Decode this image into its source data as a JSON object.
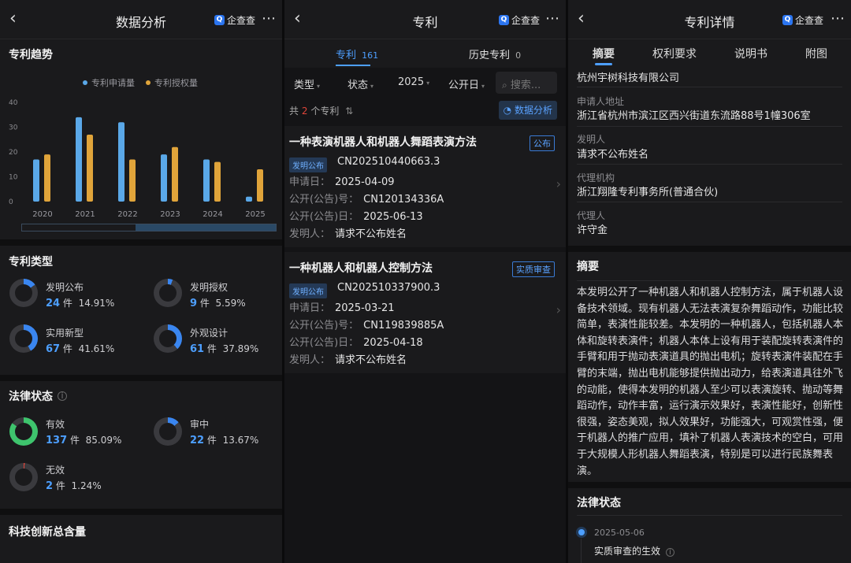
{
  "brand": {
    "name": "企查查",
    "logo_letter": "Q"
  },
  "panel1": {
    "title": "数据分析",
    "trend_title": "专利趋势",
    "type_title": "专利类型",
    "legal_title": "法律状态",
    "innovation_title": "科技创新总含量",
    "types": [
      {
        "label": "发明公布",
        "count": "24",
        "unit": "件",
        "pct": "14.91%",
        "ratio": 0.1491
      },
      {
        "label": "发明授权",
        "count": "9",
        "unit": "件",
        "pct": "5.59%",
        "ratio": 0.0559
      },
      {
        "label": "实用新型",
        "count": "67",
        "unit": "件",
        "pct": "41.61%",
        "ratio": 0.4161
      },
      {
        "label": "外观设计",
        "count": "61",
        "unit": "件",
        "pct": "37.89%",
        "ratio": 0.3789
      }
    ],
    "legal": [
      {
        "label": "有效",
        "count": "137",
        "unit": "件",
        "pct": "85.09%",
        "ratio": 0.8509,
        "color": "#3ec46d"
      },
      {
        "label": "审中",
        "count": "22",
        "unit": "件",
        "pct": "13.67%",
        "ratio": 0.1367,
        "color": "#3a86f0"
      },
      {
        "label": "无效",
        "count": "2",
        "unit": "件",
        "pct": "1.24%",
        "ratio": 0.0124,
        "color": "#e0453a"
      }
    ]
  },
  "chart_data": {
    "type": "bar",
    "categories": [
      "2020",
      "2021",
      "2022",
      "2023",
      "2024",
      "2025"
    ],
    "series": [
      {
        "name": "专利申请量",
        "values": [
          17,
          34,
          32,
          19,
          17,
          2
        ],
        "color": "#5aa8e8"
      },
      {
        "name": "专利授权量",
        "values": [
          19,
          27,
          17,
          22,
          16,
          13
        ],
        "color": "#e0a43a"
      }
    ],
    "yticks": [
      "0",
      "10",
      "20",
      "30",
      "40"
    ],
    "ylim": [
      0,
      40
    ],
    "legend": "top-center"
  },
  "panel2": {
    "title": "专利",
    "tabs": [
      {
        "label": "专利",
        "count": "161"
      },
      {
        "label": "历史专利",
        "count": "0"
      }
    ],
    "filters": [
      "类型",
      "状态",
      "2025",
      "公开日"
    ],
    "search_placeholder": "搜索...",
    "total_prefix": "共",
    "total_count": "2",
    "total_suffix": "个专利",
    "analysis_btn": "数据分析",
    "cards": [
      {
        "title": "一种表演机器人和机器人舞蹈表演方法",
        "badge": "公布",
        "tag": "发明公布",
        "number": "CN202510440663.3",
        "apply_label": "申请日：",
        "apply_date": "2025-04-09",
        "pub_no_label": "公开(公告)号：",
        "pub_no": "CN120134336A",
        "pub_date_label": "公开(公告)日：",
        "pub_date": "2025-06-13",
        "inventor_label": "发明人：",
        "inventor": "请求不公布姓名"
      },
      {
        "title": "一种机器人和机器人控制方法",
        "badge": "实质审查",
        "tag": "发明公布",
        "number": "CN202510337900.3",
        "apply_label": "申请日：",
        "apply_date": "2025-03-21",
        "pub_no_label": "公开(公告)号：",
        "pub_no": "CN119839885A",
        "pub_date_label": "公开(公告)日：",
        "pub_date": "2025-04-18",
        "inventor_label": "发明人：",
        "inventor": "请求不公布姓名"
      }
    ]
  },
  "panel3": {
    "title": "专利详情",
    "tabs": [
      "摘要",
      "权利要求",
      "说明书",
      "附图"
    ],
    "applicant": "杭州宇树科技有限公司",
    "address_label": "申请人地址",
    "address": "浙江省杭州市滨江区西兴街道东流路88号1幢306室",
    "inventor_label": "发明人",
    "inventor": "请求不公布姓名",
    "agency_label": "代理机构",
    "agency": "浙江翔隆专利事务所(普通合伙)",
    "agent_label": "代理人",
    "agent": "许守金",
    "abstract_title": "摘要",
    "abstract": "本发明公开了一种机器人和机器人控制方法，属于机器人设备技术领域。现有机器人无法表演复杂舞蹈动作，功能比较简单，表演性能较差。本发明的一种机器人，包括机器人本体和旋转表演件；机器人本体上设有用于装配旋转表演件的手臂和用于抛动表演道具的抛出电机；旋转表演件装配在手臂的末端，抛出电机能够提供抛出动力，给表演道具往外飞的动能，使得本发明的机器人至少可以表演旋转、抛动等舞蹈动作，动作丰富，运行演示效果好，表演性能好，创新性很强，姿态美观，拟人效果好，功能强大，可观赏性强，便于机器人的推广应用，填补了机器人表演技术的空白，可用于大规模人形机器人舞蹈表演，特别是可以进行民族舞表演。",
    "legal_title": "法律状态",
    "legal_date": "2025-05-06",
    "legal_event": "实质审查的生效"
  }
}
